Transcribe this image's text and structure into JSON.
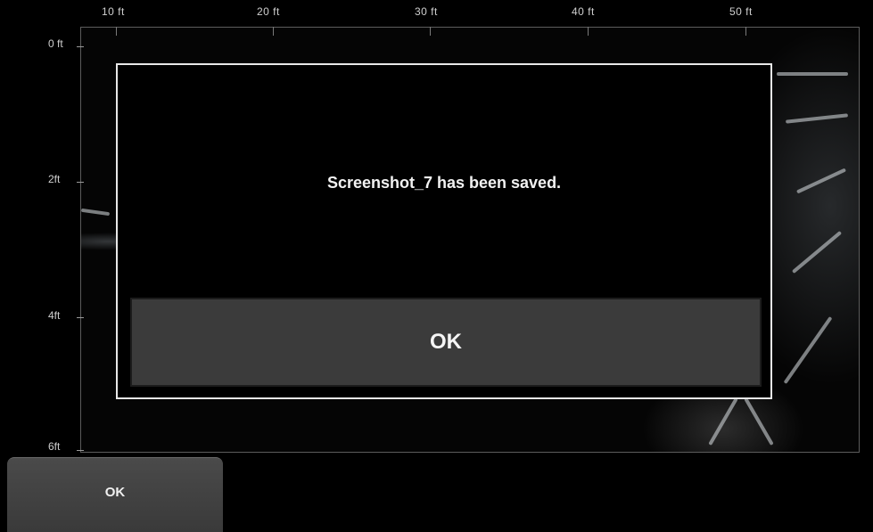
{
  "axis": {
    "x_ticks": [
      "10 ft",
      "20 ft",
      "30 ft",
      "40 ft",
      "50 ft"
    ],
    "y_ticks": [
      "0 ft",
      "2ft",
      "4ft",
      "6ft"
    ]
  },
  "dialog": {
    "message": "Screenshot_7 has been saved.",
    "ok_label": "OK"
  },
  "footer": {
    "ok_label": "OK"
  },
  "colors": {
    "background": "#000000",
    "dialog_border": "#e8e8e8",
    "button": "#3b3b3b"
  }
}
